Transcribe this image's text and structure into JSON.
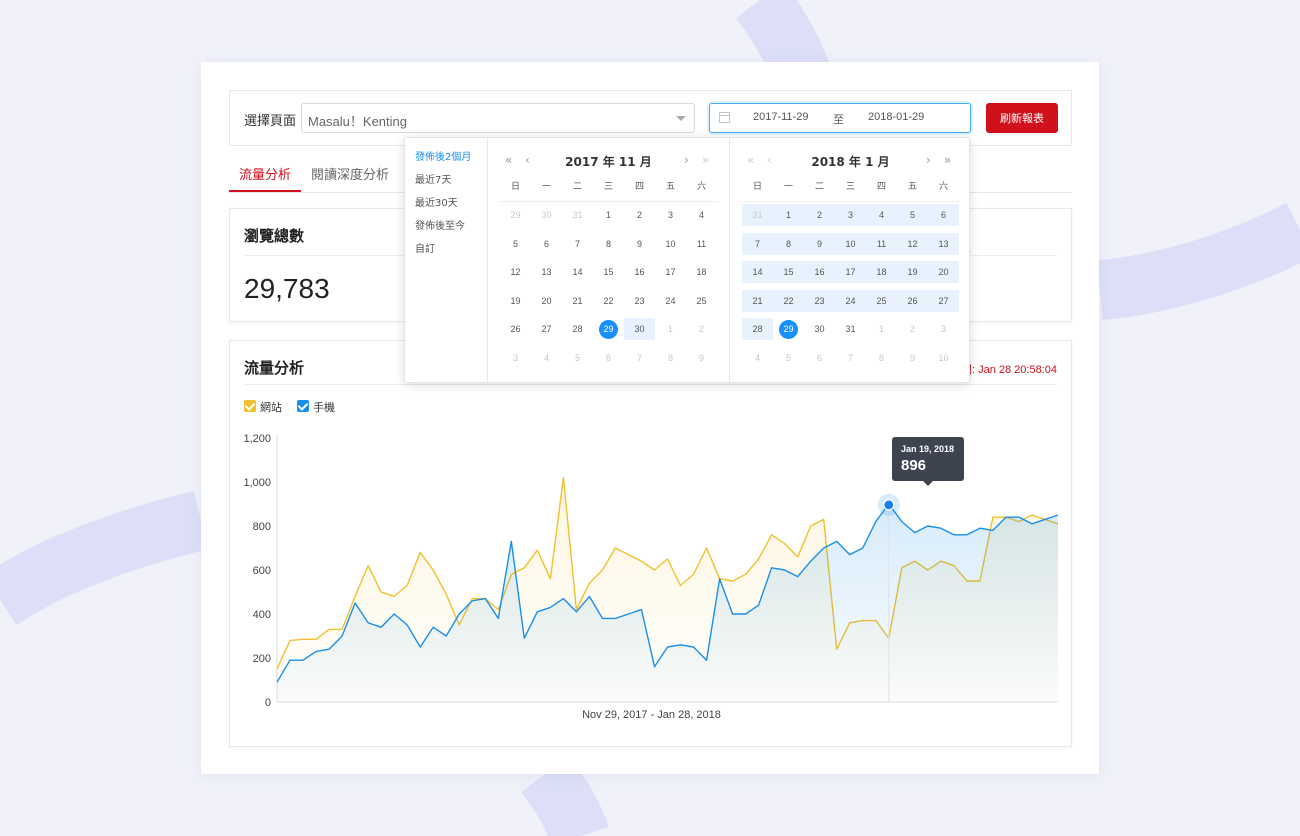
{
  "colors": {
    "accent_red": "#d0111b",
    "accent_blue": "#1890ff",
    "series_website": "#f2c02e",
    "series_mobile": "#1a8fea",
    "background": "#f0f1f9"
  },
  "toolbar": {
    "page_label": "選擇頁面",
    "page_value": "Masalu！Kenting",
    "date_start": "2017-11-29",
    "date_sep": "至",
    "date_end": "2018-01-29",
    "refresh_label": "刷新報表",
    "icons": [
      "calendar-icon",
      "chevron-down-icon"
    ]
  },
  "tabs": [
    {
      "label": "流量分析",
      "active": true
    },
    {
      "label": "閱讀深度分析",
      "active": false
    }
  ],
  "summary_card": {
    "title": "瀏覽總數",
    "value": "29,783"
  },
  "chart_card": {
    "title": "流量分析",
    "updated_text": "間: Jan 28 20:58:04",
    "legend": [
      {
        "label": "網站",
        "color": "#f2c02e",
        "checked": true
      },
      {
        "label": "手機",
        "color": "#1a8fea",
        "checked": true
      }
    ],
    "tooltip": {
      "date": "Jan 19, 2018",
      "value": "896"
    }
  },
  "chart_data": {
    "type": "area",
    "xlabel": "Nov 29, 2017 - Jan 28, 2018",
    "ylabel": "",
    "ylim": [
      0,
      1200
    ],
    "yticks": [
      "0",
      "200",
      "400",
      "600",
      "800",
      "1,000",
      "1,200"
    ],
    "x_start": "2017-11-29",
    "x_end": "2018-01-28",
    "grid": false,
    "legend_position": "top-left",
    "series": [
      {
        "name": "網站",
        "color": "#f2c02e",
        "values": [
          150,
          280,
          285,
          285,
          330,
          330,
          480,
          620,
          500,
          480,
          530,
          680,
          600,
          490,
          350,
          470,
          470,
          420,
          580,
          610,
          690,
          560,
          1020,
          420,
          540,
          600,
          700,
          670,
          640,
          600,
          650,
          530,
          580,
          700,
          560,
          550,
          580,
          650,
          760,
          720,
          660,
          800,
          830,
          240,
          360,
          370,
          370,
          290,
          610,
          640,
          600,
          640,
          620,
          550,
          550,
          840,
          840,
          820,
          850,
          830,
          810
        ]
      },
      {
        "name": "手機",
        "color": "#1a8fea",
        "values": [
          90,
          190,
          190,
          230,
          240,
          300,
          450,
          360,
          340,
          400,
          350,
          250,
          340,
          300,
          400,
          460,
          470,
          380,
          730,
          290,
          410,
          430,
          470,
          410,
          480,
          380,
          380,
          400,
          420,
          160,
          250,
          260,
          250,
          190,
          560,
          400,
          400,
          440,
          610,
          600,
          570,
          640,
          700,
          730,
          670,
          700,
          820,
          900,
          820,
          770,
          800,
          790,
          760,
          760,
          790,
          780,
          840,
          840,
          810,
          830,
          850
        ]
      }
    ],
    "highlight": {
      "date": "Jan 19, 2018",
      "value": 896
    }
  },
  "calendar": {
    "presets": [
      {
        "label": "發佈後2個月",
        "active": true
      },
      {
        "label": "最近7天",
        "active": false
      },
      {
        "label": "最近30天",
        "active": false
      },
      {
        "label": "發佈後至今",
        "active": false
      },
      {
        "label": "自訂",
        "active": false
      }
    ],
    "weekdays": [
      "日",
      "一",
      "二",
      "三",
      "四",
      "五",
      "六"
    ],
    "nav": {
      "prev_year": "«",
      "prev_month": "‹",
      "next_month": "›",
      "next_year": "»"
    },
    "left": {
      "title": "2017 年 11 月",
      "days": [
        "29",
        "30",
        "31",
        "1",
        "2",
        "3",
        "4",
        "5",
        "6",
        "7",
        "8",
        "9",
        "10",
        "11",
        "12",
        "13",
        "14",
        "15",
        "16",
        "17",
        "18",
        "19",
        "20",
        "21",
        "22",
        "23",
        "24",
        "25",
        "26",
        "27",
        "28",
        "29",
        "30",
        "1",
        "2",
        "3",
        "4",
        "5",
        "6",
        "7",
        "8",
        "9"
      ],
      "in_month_from": 3,
      "in_month_to": 32,
      "selected_index": 31,
      "range_from": 31,
      "range_to": 32
    },
    "right": {
      "title": "2018 年 1 月",
      "days": [
        "31",
        "1",
        "2",
        "3",
        "4",
        "5",
        "6",
        "7",
        "8",
        "9",
        "10",
        "11",
        "12",
        "13",
        "14",
        "15",
        "16",
        "17",
        "18",
        "19",
        "20",
        "21",
        "22",
        "23",
        "24",
        "25",
        "26",
        "27",
        "28",
        "29",
        "30",
        "31",
        "1",
        "2",
        "3",
        "4",
        "5",
        "6",
        "7",
        "8",
        "9",
        "10"
      ],
      "in_month_from": 1,
      "in_month_to": 31,
      "selected_index": 29,
      "range_from": 0,
      "range_to": 29
    }
  }
}
